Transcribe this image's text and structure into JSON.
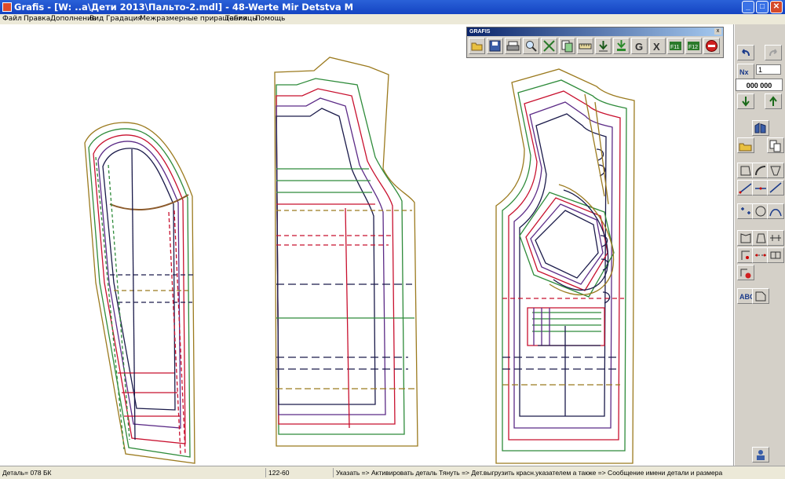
{
  "window": {
    "title": "Grafis - [W: ..а\\Дети 2013\\Пальто-2.mdl] - 48-Werte Mir Detstva M",
    "minimize": "_",
    "maximize": "□",
    "close": "✕"
  },
  "menu": [
    "Файл",
    "Правка",
    "Дополнение",
    "Вид",
    "Градация",
    "Межразмерные приращения",
    "Таблицы",
    "Помощь"
  ],
  "floating_toolbar": {
    "caption": "GRAFIS",
    "close": "x",
    "buttons": [
      "open-folder-icon",
      "save-icon",
      "print-icon",
      "zoom-icon",
      "fit-view-icon",
      "copy-icon",
      "ruler-icon",
      "arrow-down-icon",
      "arrow-down-green-icon",
      "g-icon",
      "x-icon",
      "f11-icon",
      "f12-icon",
      "stop-icon"
    ]
  },
  "right_panel": {
    "input_value": "1",
    "counter": "000 000"
  },
  "status": {
    "detail": "Деталь= 078  БК",
    "coords": "122-60",
    "hint": "Указать => Активировать деталь Тянуть => Дет.выгрузить красн.указателем а также => Сообщение имени детали и размера"
  },
  "colors": {
    "titlebar": "#1444c2",
    "outline_gold": "#9b7a1e",
    "line_green": "#2e8b3a",
    "line_red": "#c8102e",
    "line_purple": "#5b2a86",
    "line_navy": "#1a1a4a"
  }
}
